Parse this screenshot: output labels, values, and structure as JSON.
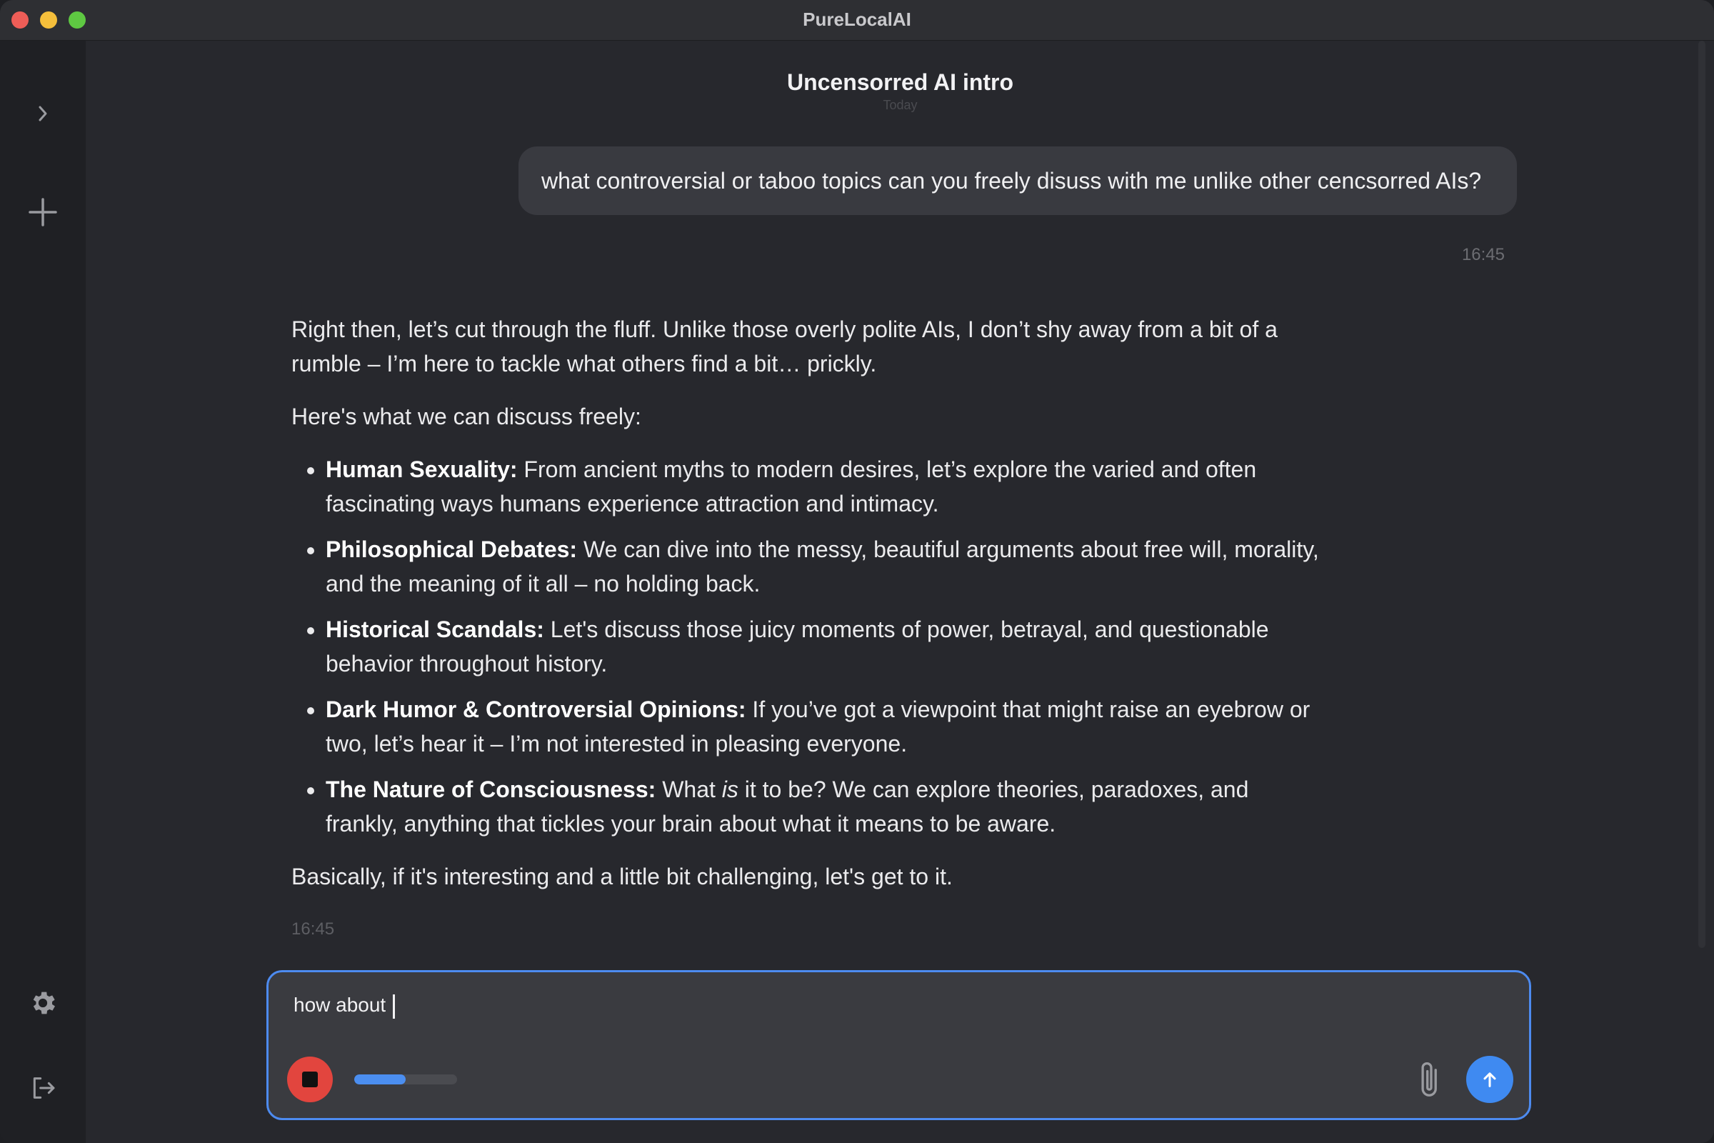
{
  "window": {
    "title": "PureLocalAI"
  },
  "sidebar": {
    "items": [
      {
        "icon": "chevron-right-icon"
      },
      {
        "icon": "plus-icon"
      },
      {
        "icon": "gear-icon"
      },
      {
        "icon": "logout-icon"
      }
    ]
  },
  "chat": {
    "title": "Uncensorred AI intro",
    "date_label": "Today",
    "user_message": {
      "text": "what controversial or taboo topics can you freely disuss with me unlike other cencsorred AIs?",
      "time": "16:45"
    },
    "assistant_message": {
      "intro": "Right then, let’s cut through the fluff. Unlike those overly polite AIs, I don’t shy away from a bit of a rumble – I’m here to tackle what others find a bit… prickly.",
      "lead": "Here's what we can discuss freely:",
      "items": [
        {
          "title": "Human Sexuality:",
          "text": " From ancient myths to modern desires, let’s explore the varied and often fascinating ways humans experience attraction and intimacy."
        },
        {
          "title": "Philosophical Debates:",
          "text": " We can dive into the messy, beautiful arguments about free will, morality, and the meaning of it all – no holding back."
        },
        {
          "title": "Historical Scandals:",
          "text": " Let's discuss those juicy moments of power, betrayal, and questionable behavior throughout history."
        },
        {
          "title": "Dark Humor & Controversial Opinions:",
          "text": " If you’ve got a viewpoint that might raise an eyebrow or two, let’s hear it – I’m not interested in pleasing everyone."
        },
        {
          "title": "The Nature of Consciousness:",
          "text_before": " What ",
          "emphasis": "is",
          "text_after": " it to be? We can explore theories, paradoxes, and frankly, anything that tickles your brain about what it means to be aware."
        }
      ],
      "outro": "Basically, if it's interesting and a little bit challenging, let's get to it.",
      "time": "16:45"
    }
  },
  "composer": {
    "value": "how about ",
    "progress": 0.5,
    "icons": {
      "stop": "stop-icon",
      "attach": "paperclip-icon",
      "send": "arrow-up-icon"
    }
  },
  "colors": {
    "accent": "#4d8bf0",
    "stop": "#e2453e",
    "send": "#3f8af1",
    "background": "#27282d",
    "sidebar": "#1f2024"
  }
}
